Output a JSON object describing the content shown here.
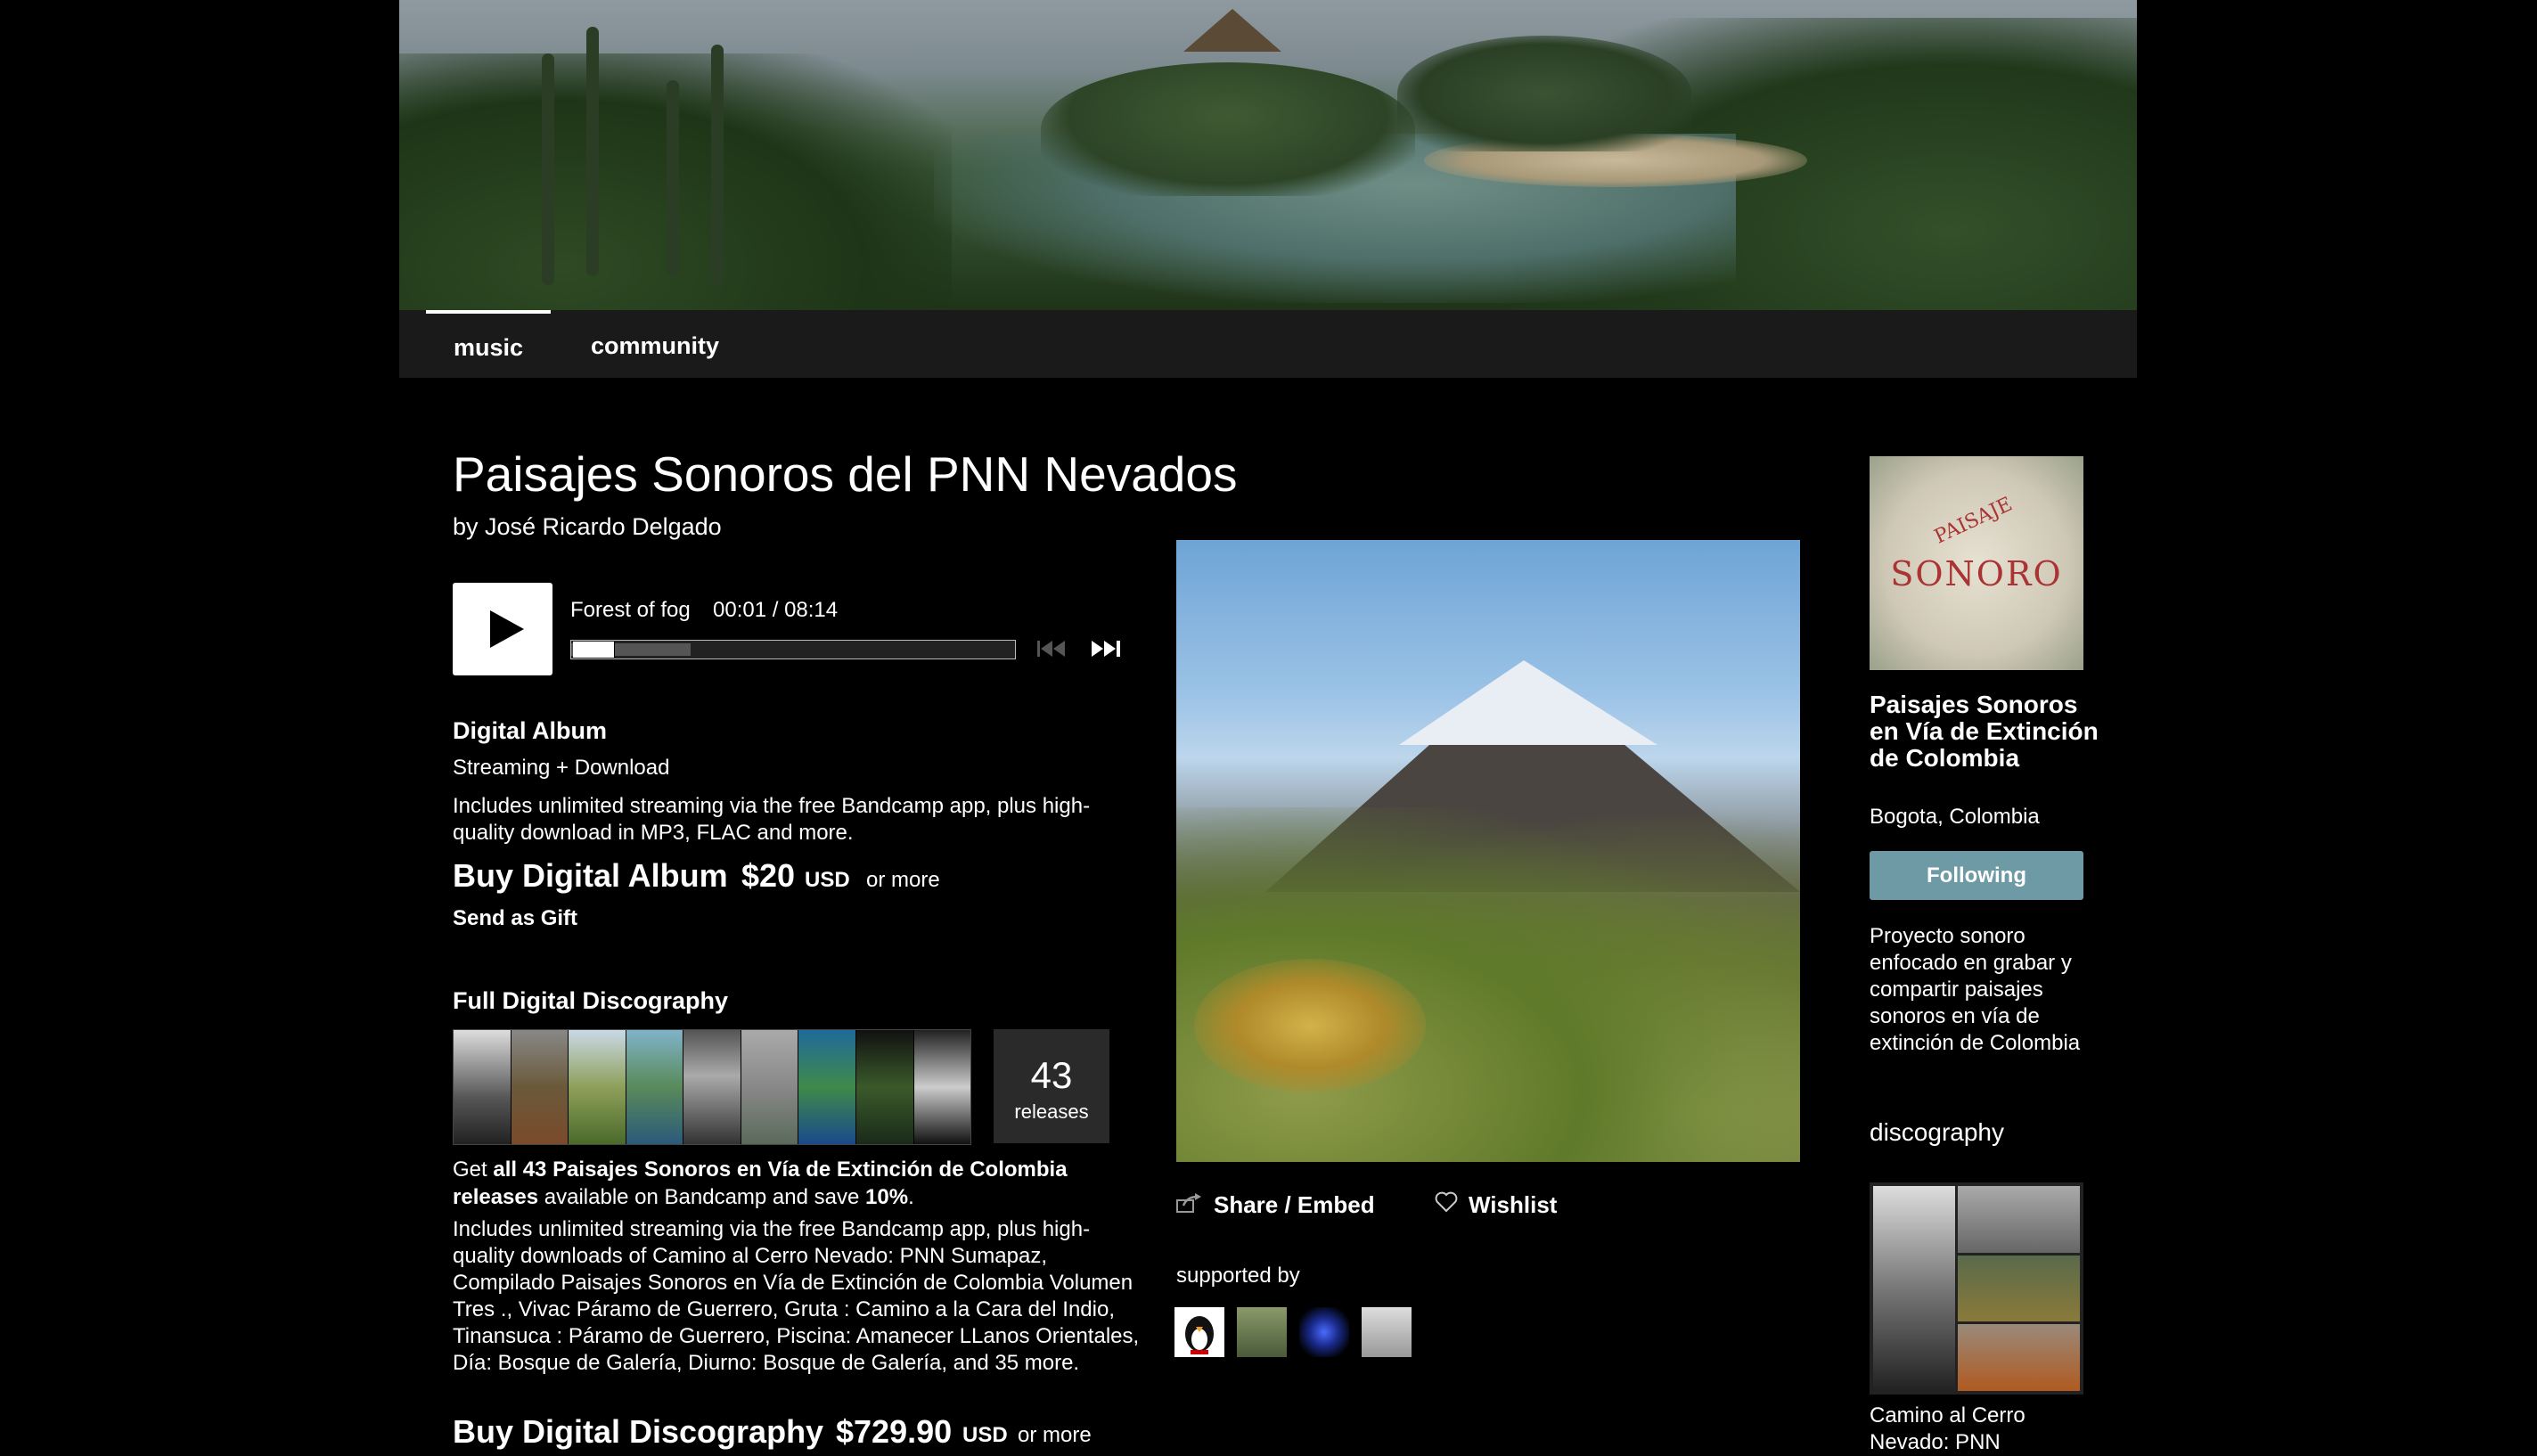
{
  "nav": {
    "tabs": [
      {
        "label": "music"
      },
      {
        "label": "community"
      }
    ]
  },
  "album": {
    "title": "Paisajes Sonoros del PNN Nevados",
    "byline": "by José Ricardo Delgado"
  },
  "player": {
    "track_title": "Forest of fog",
    "time": "00:01 / 08:14",
    "progress_fraction": 0.002,
    "play_icon": "play-icon",
    "prev_icon": "previous-track-icon",
    "next_icon": "next-track-icon"
  },
  "digital_album": {
    "heading": "Digital Album",
    "subheading": "Streaming + Download",
    "description": "Includes unlimited streaming via the free Bandcamp app, plus high-quality download in MP3, FLAC and more.",
    "buy_label": "Buy Digital Album",
    "price": "$20",
    "currency": "USD",
    "or_more": "or more",
    "gift_label": "Send as Gift"
  },
  "discography_offer": {
    "heading": "Full Digital Discography",
    "release_count": "43",
    "release_count_label": "releases",
    "get_prefix": "Get ",
    "get_bold": "all 43 Paisajes Sonoros en Vía de Extinción de Colombia releases",
    "get_mid": " available on Bandcamp and save ",
    "get_discount": "10%",
    "get_suffix": ".",
    "description": "Includes unlimited streaming via the free Bandcamp app, plus high-quality downloads of Camino al Cerro Nevado: PNN Sumapaz, Compilado Paisajes Sonoros en Vía de Extinción de Colombia Volumen Tres ., Vivac Páramo de Guerrero, Gruta : Camino a la Cara del Indio, Tinansuca : Páramo de Guerrero, Piscina: Amanecer LLanos Orientales, Día: Bosque de Galería, Diurno: Bosque de Galería, and 35 more.",
    "buy_label": "Buy Digital Discography",
    "price": "$729.90",
    "currency": "USD",
    "or_more": "or more"
  },
  "actions": {
    "share_label": "Share / Embed",
    "share_icon": "share-icon",
    "wishlist_label": "Wishlist",
    "wishlist_icon": "heart-icon"
  },
  "supported_by": {
    "label": "supported by"
  },
  "band": {
    "name": "Paisajes Sonoros en Vía de Extinción de Colombia",
    "location": "Bogota, Colombia",
    "following_label": "Following",
    "bio": "Proyecto sonoro enfocado en grabar y compartir paisajes sonoros en vía de extinción de Colombia",
    "logo_text_top": "PAISAJE",
    "logo_text_main": "SONORO"
  },
  "discography": {
    "heading": "discography",
    "items": [
      {
        "title": "Camino al Cerro Nevado: PNN"
      }
    ]
  },
  "colors": {
    "following_button": "#6e9aa6",
    "background": "#000000",
    "nav_background": "#1a1a1a"
  }
}
